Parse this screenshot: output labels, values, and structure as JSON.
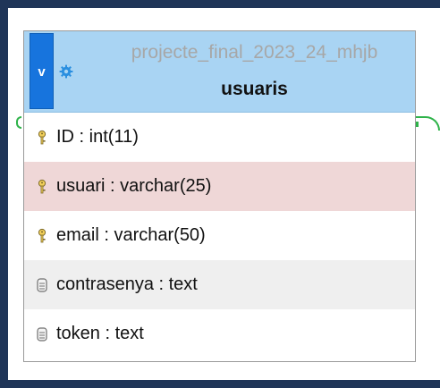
{
  "table": {
    "toggle_glyph": "v",
    "database_name": "projecte_final_2023_24_mhjb",
    "table_name": "usuaris",
    "header_color": "#a9d4f3",
    "toggle_color": "#1774dd",
    "columns": [
      {
        "label": "ID : int(11)",
        "icon": "key-icon",
        "highlighted": false
      },
      {
        "label": "usuari : varchar(25)",
        "icon": "key-icon",
        "highlighted": true
      },
      {
        "label": "email : varchar(50)",
        "icon": "key-icon",
        "highlighted": false
      },
      {
        "label": "contrasenya : text",
        "icon": "column-icon",
        "highlighted": false
      },
      {
        "label": "token : text",
        "icon": "column-icon",
        "highlighted": false
      }
    ]
  },
  "colors": {
    "frame": "#1f3558",
    "relation_line": "#2fb34a",
    "highlight_row": "#efd7d7"
  }
}
